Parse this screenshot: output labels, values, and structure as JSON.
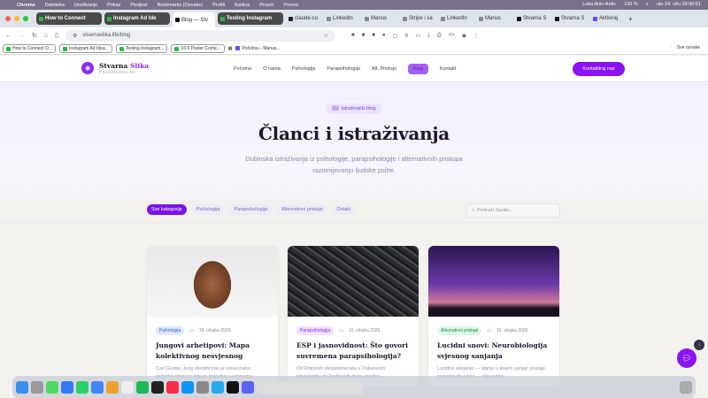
{
  "menubar": {
    "app": "Chrome",
    "items": [
      "Datoteka",
      "Uređivanje",
      "Prikaz",
      "Povijest",
      "Bookmarks (Oznake)",
      "Profili",
      "Kartica",
      "Prozor",
      "Pomoć"
    ],
    "user": "Luka Anic-Antic",
    "battery": "100 %",
    "datetime": "uto 24. ožu 03:50:51"
  },
  "tabs": [
    "How to Connect",
    "Instagram Ad Ide",
    "Blog — Stv",
    "Testing Instagram",
    "claude-co",
    "LinkedIn",
    "Manus",
    "Stripe i sa",
    "LinkedIn",
    "Manus",
    "Stvarna S",
    "Stvarna S",
    "Aktiviraj"
  ],
  "url": "stvarnaslika.life/blog",
  "bookmarks": [
    "How to Connect O...",
    "Instagram Ad Idea...",
    "Testing Instagram...",
    "16:9 Poster Comic...",
    "Početna – Manus..."
  ],
  "bookmarks_all": "Sve oznake",
  "site": {
    "brand1": "Stvarna",
    "brand2": "Slika",
    "brand_sub": "PSIHOLOGIJA",
    "nav": [
      "Početna",
      "O nama",
      "Psihologija",
      "Parapsihologija",
      "Alt. Pristupi",
      "Blog",
      "Kontakt"
    ],
    "cta": "Kontaktiraj nas"
  },
  "hero": {
    "pill": "Istraživački blog",
    "title": "Članci i istraživanja",
    "subtitle": "Dubinska istraživanja iz psihologije, parapsihologije i alternativnih pristupa razumijevanju ljudske psihe."
  },
  "filters": {
    "chips": [
      "Sve kategorije",
      "Psihologija",
      "Parapsihologija",
      "Alternativni pristupi",
      "Ostalo"
    ],
    "search_placeholder": "Pretraži članke..."
  },
  "articles": [
    {
      "tag": "Psihologija",
      "tag_color": "#dce8ff",
      "date": "16. ožujka 2026.",
      "title": "Jungovi arhetipovi: Mapa kolektivnog nesvjesnog",
      "excerpt": "Carl Gustav Jung identificirao je univerzalne psihičke obrasce koji se pojavljuju u snovima,"
    },
    {
      "tag": "Parapsihologija",
      "tag_color": "#efe2fd",
      "date": "16. ožujka 2026.",
      "title": "ESP i jasnovidnost: Što govori suvremena parapsihologija?",
      "excerpt": "Od Rhinovih eksperimenata u Dukeovom laboratoriju do Radinovih meta-analiza —"
    },
    {
      "tag": "Alternativni pristupi",
      "tag_color": "#dcf7e6",
      "date": "16. ožujka 2026.",
      "title": "Lucidni snovi: Neurobiologija svjesnog sanjanja",
      "excerpt": "Lucidno sanjanje — stanje u kojem sanjač postaje svjestan da sanja — nije samo"
    }
  ]
}
